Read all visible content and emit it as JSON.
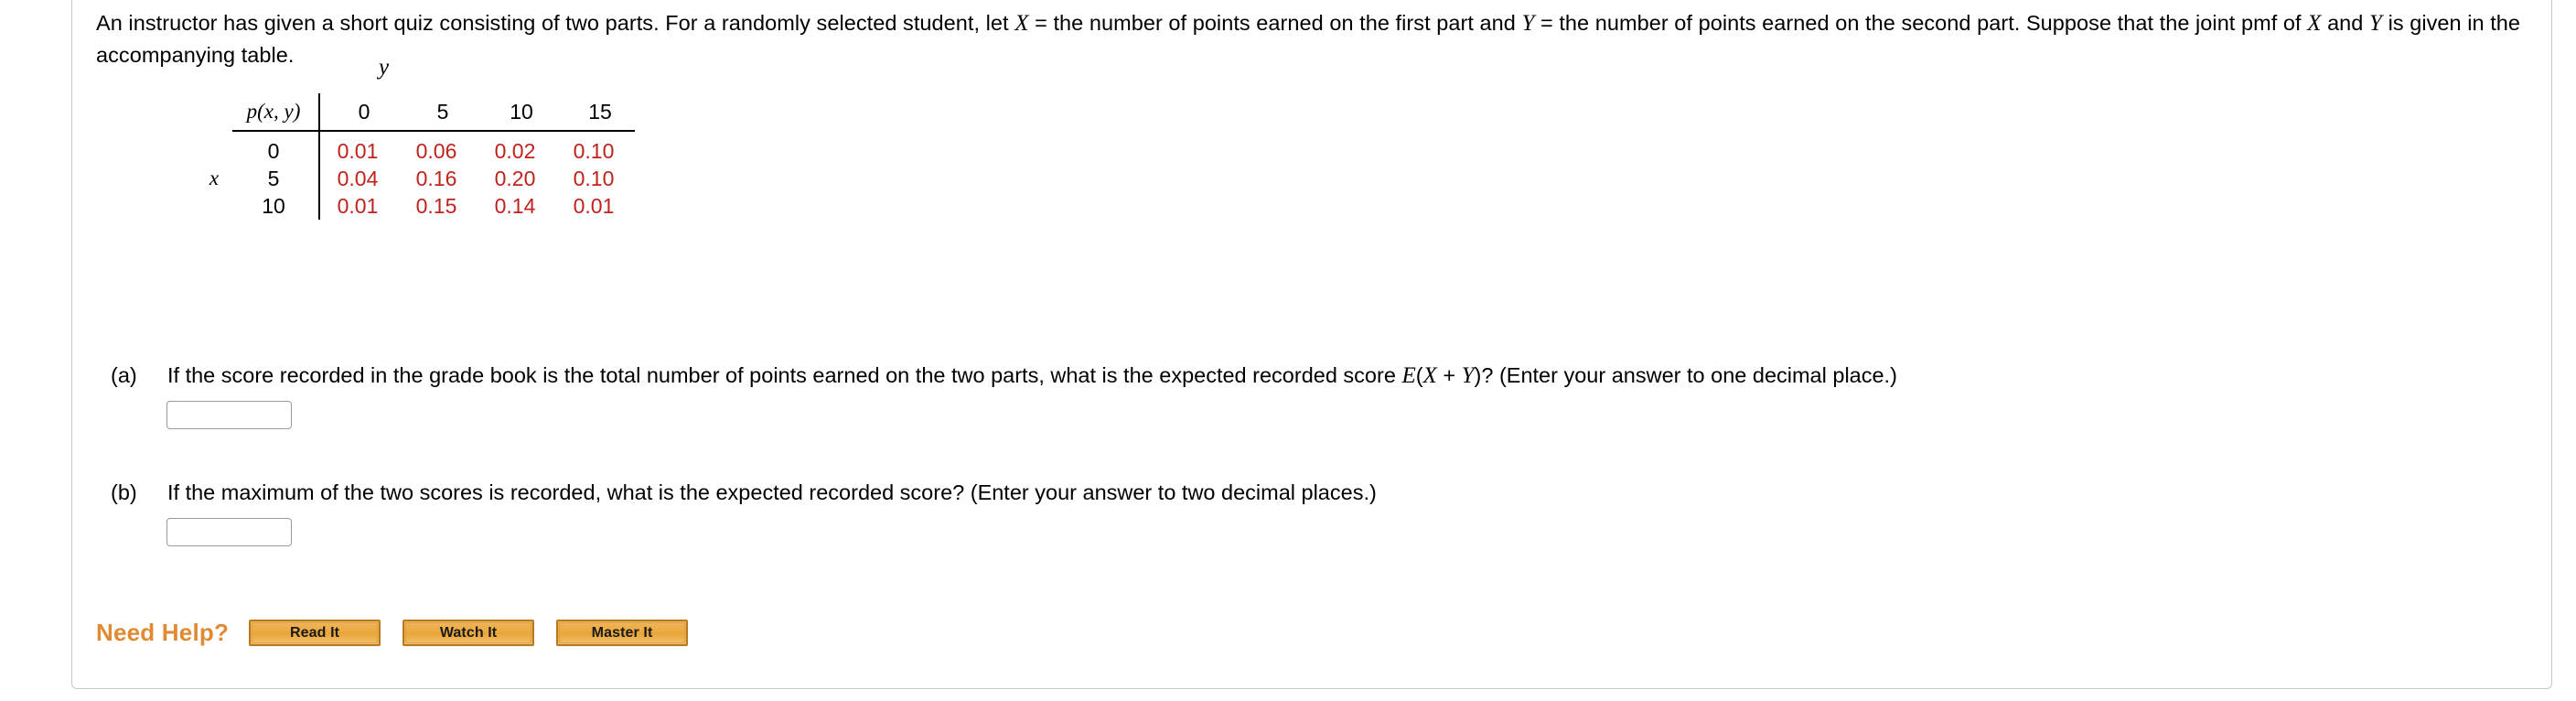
{
  "problem": {
    "sentence1_a": "An instructor has given a short quiz consisting of two parts. For a randomly selected student, let ",
    "var_X": "X",
    "sentence1_b": " = the number of points earned on the first part and ",
    "var_Y": "Y",
    "sentence1_c": " = the number of points earned on the second part. Suppose that the joint pmf of ",
    "var_X2": "X",
    "sentence1_d": " and ",
    "var_Y2": "Y",
    "sentence1_e": " is given in the accompanying table."
  },
  "table": {
    "y_axis_label": "y",
    "x_axis_label": "x",
    "corner_label": "p(x, y)",
    "column_headers": [
      "0",
      "5",
      "10",
      "15"
    ],
    "row_headers": [
      "0",
      "5",
      "10"
    ],
    "value_color": "#c0221c",
    "rows": [
      [
        "0.01",
        "0.06",
        "0.02",
        "0.10"
      ],
      [
        "0.04",
        "0.16",
        "0.20",
        "0.10"
      ],
      [
        "0.01",
        "0.15",
        "0.14",
        "0.01"
      ]
    ]
  },
  "questions": [
    {
      "tag": "(a)",
      "text_a": "If the score recorded in the grade book is the total number of points earned on the two parts, what is the expected recorded score ",
      "expr_E": "E",
      "expr_open": "(",
      "expr_X": "X",
      "expr_plus": " + ",
      "expr_Y": "Y",
      "expr_close": ")",
      "text_b": "? (Enter your answer to one decimal place.)",
      "answer_value": "",
      "answer_placeholder": ""
    },
    {
      "tag": "(b)",
      "text_a": "If the maximum of the two scores is recorded, what is the expected recorded score? (Enter your answer to two decimal places.)",
      "answer_value": "",
      "answer_placeholder": ""
    }
  ],
  "need_help": {
    "label": "Need Help?",
    "label_color": "#e08a33",
    "buttons": [
      {
        "label": "Read It"
      },
      {
        "label": "Watch It"
      },
      {
        "label": "Master It"
      }
    ]
  }
}
